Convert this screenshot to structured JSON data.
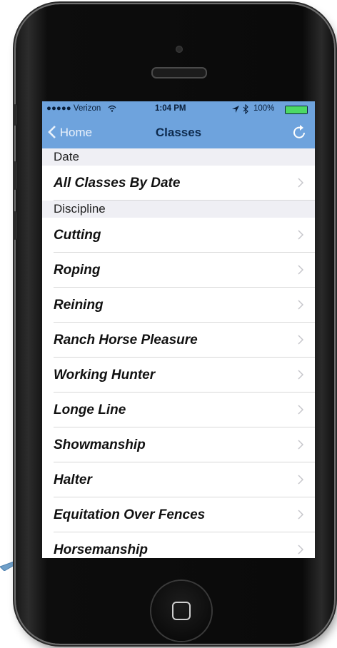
{
  "colors": {
    "nav_bg": "#6ea3dd",
    "section_bg": "#efeff4",
    "battery": "#4cd964",
    "accent_triangle": "#6f9fc8"
  },
  "status_bar": {
    "carrier": "●●●●● Verizon",
    "wifi_icon": "wifi-icon",
    "time": "1:04 PM",
    "location_icon": "location-arrow-icon",
    "bluetooth_icon": "bluetooth-icon",
    "battery_percent": "100%"
  },
  "nav": {
    "back_label": "Home",
    "title": "Classes",
    "refresh_icon": "refresh-icon"
  },
  "sections": [
    {
      "header": "Date",
      "items": [
        "All Classes By Date"
      ]
    },
    {
      "header": "Discipline",
      "items": [
        "Cutting",
        "Roping",
        "Reining",
        "Ranch Horse Pleasure",
        "Working Hunter",
        "Longe Line",
        "Showmanship",
        "Halter",
        "Equitation Over Fences",
        "Horsemanship"
      ]
    }
  ]
}
